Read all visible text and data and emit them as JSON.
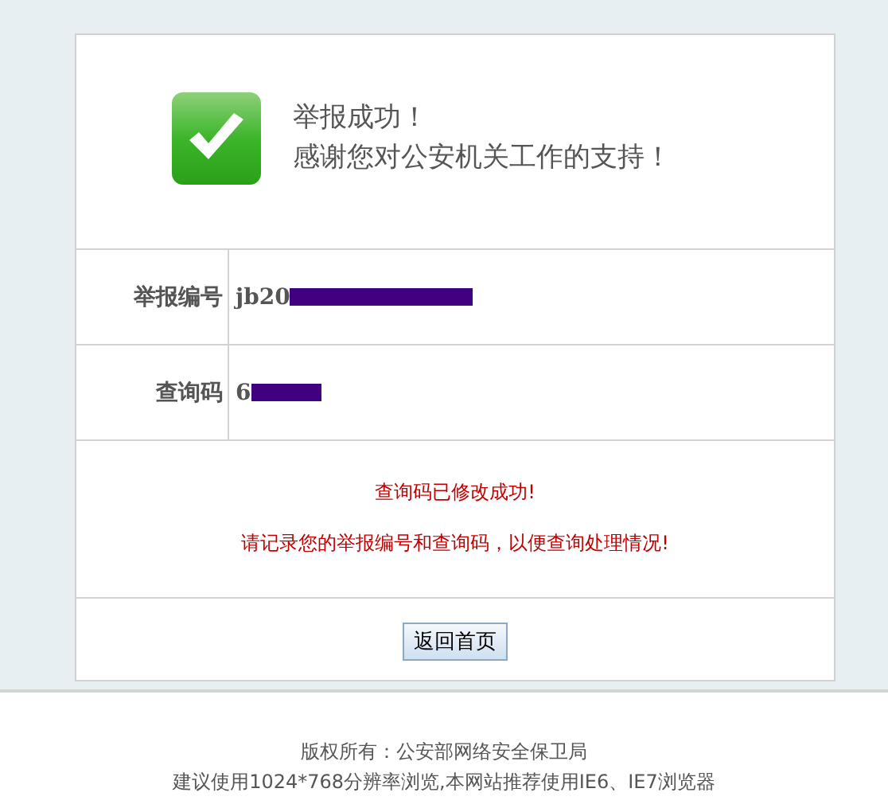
{
  "header": {
    "title": "举报成功！",
    "subtitle": "感谢您对公安机关工作的支持！"
  },
  "fields": [
    {
      "label": "举报编号",
      "value": "jb20",
      "redacted": true
    },
    {
      "label": "查询码",
      "value": "6",
      "redacted": true
    }
  ],
  "messages": [
    "查询码已修改成功!",
    "请记录您的举报编号和查询码，以便查询处理情况!"
  ],
  "button": "返回首页",
  "footer": [
    "版权所有：公安部网络安全保卫局",
    "建议使用1024*768分辨率浏览,本网站推荐使用IE6、IE7浏览器"
  ]
}
